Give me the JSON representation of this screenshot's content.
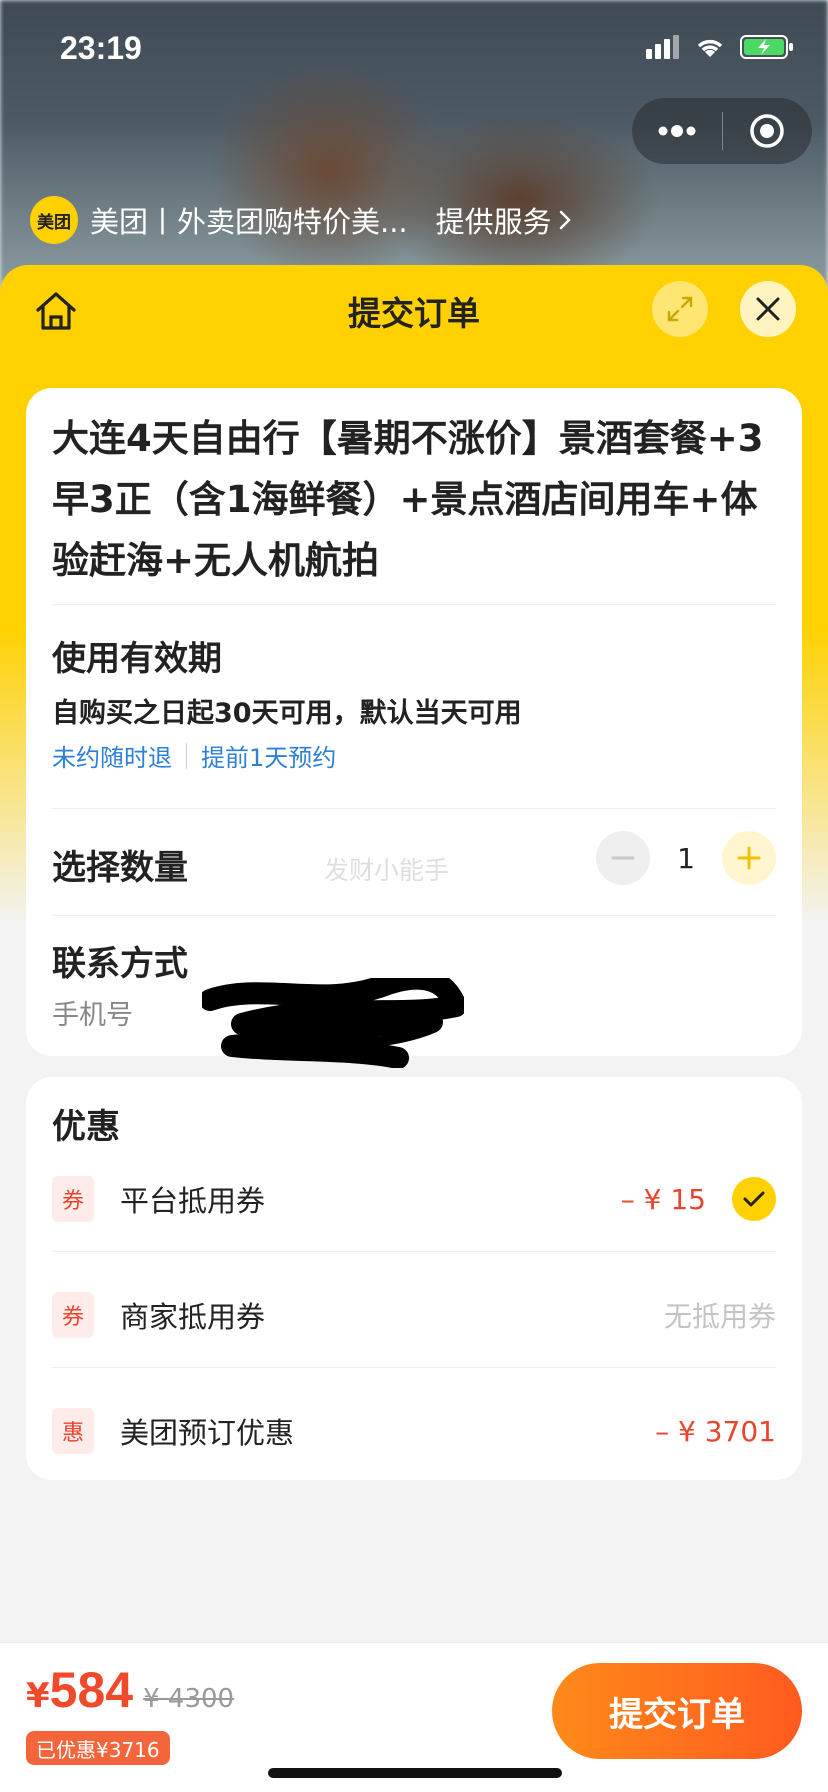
{
  "status_bar": {
    "time": "23:19"
  },
  "provider": {
    "logo_text": "美团",
    "name": "美团丨外卖团购特价美...",
    "service_label": "提供服务"
  },
  "sheet": {
    "title": "提交订单"
  },
  "product": {
    "title": "大连4天自由行【暑期不涨价】景酒套餐+3早3正（含1海鲜餐）+景点酒店间用车+体验赶海+无人机航拍"
  },
  "validity": {
    "title": "使用有效期",
    "text": "自购买之日起30天可用，默认当天可用",
    "tags": [
      "未约随时退",
      "提前1天预约"
    ]
  },
  "quantity": {
    "title": "选择数量",
    "value": "1",
    "watermark": "发财小能手"
  },
  "contact": {
    "title": "联系方式",
    "phone_label": "手机号"
  },
  "discounts": {
    "title": "优惠",
    "items": [
      {
        "badge": "券",
        "label": "平台抵用券",
        "value": "– ¥ 15",
        "checked": true
      },
      {
        "badge": "券",
        "label": "商家抵用券",
        "value": "无抵用券",
        "checked": false
      },
      {
        "badge": "惠",
        "label": "美团预订优惠",
        "value": "– ¥ 3701",
        "checked": false
      }
    ]
  },
  "footer": {
    "currency": "¥",
    "price": "584",
    "original_price": "¥ 4300",
    "saved": "已优惠¥3716",
    "submit_label": "提交订单"
  },
  "colors": {
    "brand_yellow": "#ffd100",
    "accent_red": "#e8452e",
    "link_blue": "#2d7fd8",
    "button_orange": "#ff6a1f"
  }
}
